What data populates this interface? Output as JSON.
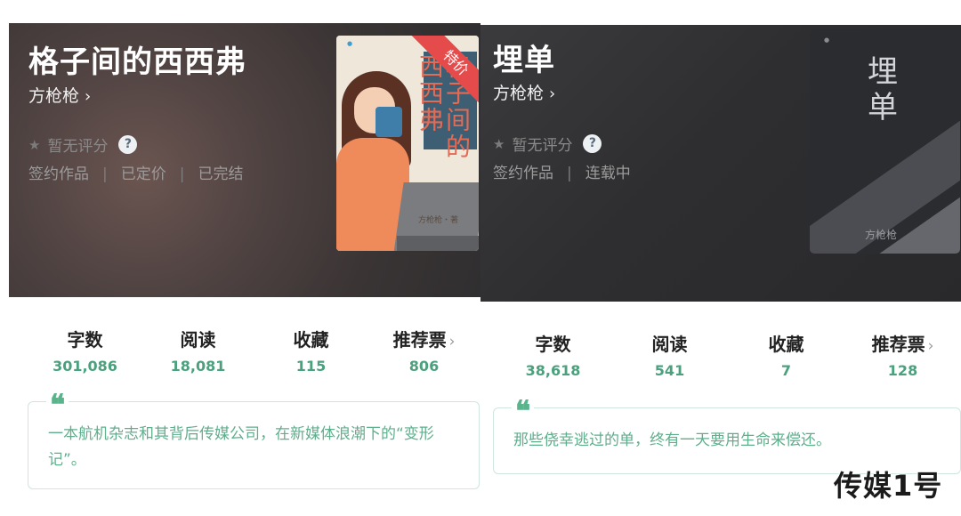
{
  "books": [
    {
      "title": "格子间的西西弗",
      "author": "方枪枪",
      "rating_icon": "star-icon",
      "rating": "暂无评分",
      "help_symbol": "?",
      "tags": [
        "签约作品",
        "已定价",
        "已完结"
      ],
      "cover": {
        "title": "格子间的西西弗",
        "author": "方枪枪・著",
        "badge": "特价"
      },
      "stats": [
        {
          "label": "字数",
          "value": "301,086"
        },
        {
          "label": "阅读",
          "value": "18,081"
        },
        {
          "label": "收藏",
          "value": "115"
        },
        {
          "label": "推荐票",
          "value": "806"
        }
      ],
      "quote_symbol": "❝",
      "intro": "一本航机杂志和其背后传媒公司，在新媒体浪潮下的“变形记”。"
    },
    {
      "title": "埋单",
      "author": "方枪枪",
      "rating_icon": "star-icon",
      "rating": "暂无评分",
      "help_symbol": "?",
      "tags": [
        "签约作品",
        "连载中"
      ],
      "cover": {
        "title": "埋单",
        "author": "方枪枪"
      },
      "stats": [
        {
          "label": "字数",
          "value": "38,618"
        },
        {
          "label": "阅读",
          "value": "541"
        },
        {
          "label": "收藏",
          "value": "7"
        },
        {
          "label": "推荐票",
          "value": "128"
        }
      ],
      "quote_symbol": "❝",
      "intro": "那些侥幸逃过的单，终有一天要用生命来偿还。"
    }
  ],
  "watermark": "传媒1号",
  "colors": {
    "accent_green": "#4ba07d",
    "intro_border": "#cfe6dc",
    "badge_red": "#e64b4b"
  }
}
